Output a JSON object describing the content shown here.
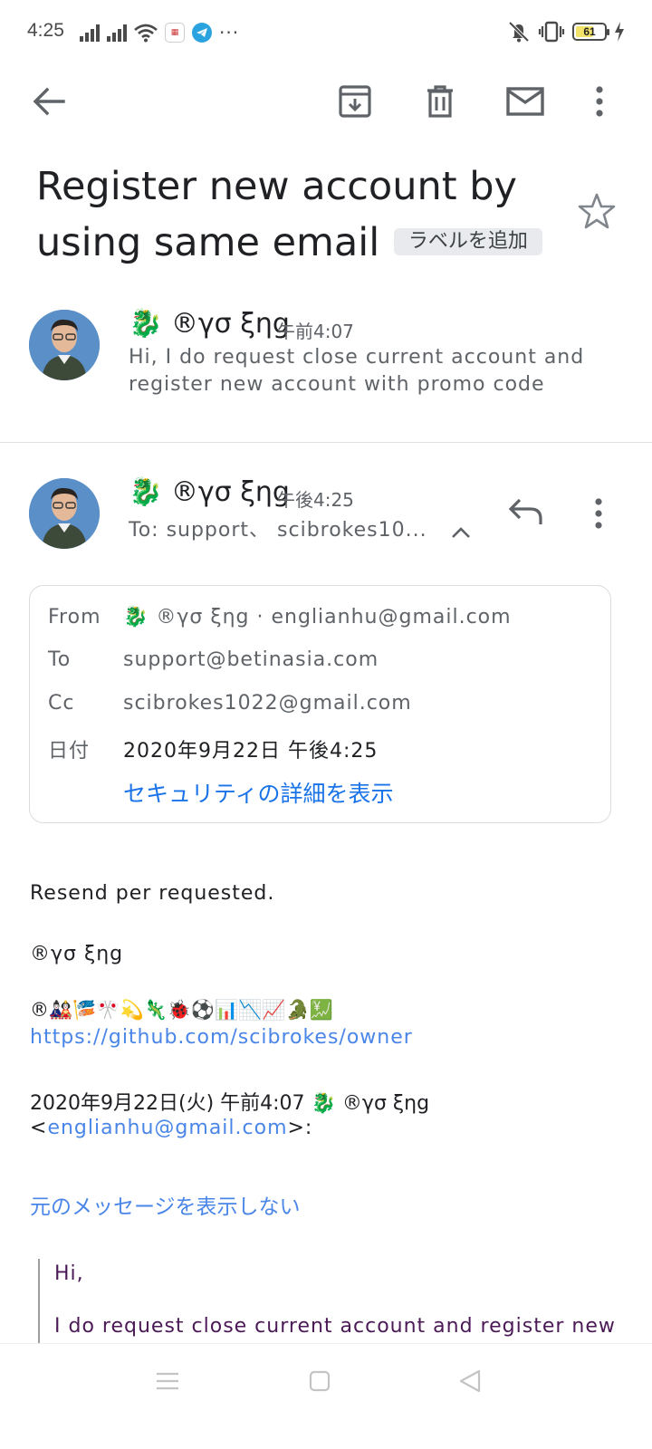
{
  "status_bar": {
    "time": "4:25",
    "battery": "61"
  },
  "subject": {
    "line1": "Register new account by",
    "line2": "using same email",
    "label_chip": "ラベルを追加"
  },
  "message1": {
    "sender": "🐉 ®γσ ξηg",
    "time": "午前4:07",
    "snippet_line1": "Hi, I do request close current account and",
    "snippet_line2": "register new account with promo code"
  },
  "message2": {
    "sender": "🐉 ®γσ ξηg",
    "time": "午後4:25",
    "to_line": "To: support、 scibrokes10..."
  },
  "details": {
    "from_label": "From",
    "from_value": "🐉 ®γσ ξηg · englianhu@gmail.com",
    "to_label": "To",
    "to_value": "support@betinasia.com",
    "cc_label": "Cc",
    "cc_value": "scibrokes1022@gmail.com",
    "date_label": "日付",
    "date_value": "2020年9月22日 午後4:25",
    "security_link": "セキュリティの詳細を表示"
  },
  "body": {
    "line1": "Resend per requested.",
    "line2": "®γσ ξηg",
    "emoji_line": "®🎎🎏🎌💫🦎🐞⚽📊📉📈🐊💹",
    "github_link": "https://github.com/scibrokes/owner",
    "quote_header": "2020年9月22日(火) 午前4:07 🐉 ®γσ ξηg",
    "quote_email_prefix": "<",
    "quote_email": "englianhu@gmail.com",
    "quote_email_suffix": ">:",
    "hide_original": "元のメッセージを表示しない",
    "quoted_line1": "Hi,",
    "quoted_line2": "I do request close current account and register new"
  },
  "colors": {
    "link": "#4a86e8",
    "quoted_text": "#4b1a56",
    "chip_bg": "#e8eaed"
  }
}
